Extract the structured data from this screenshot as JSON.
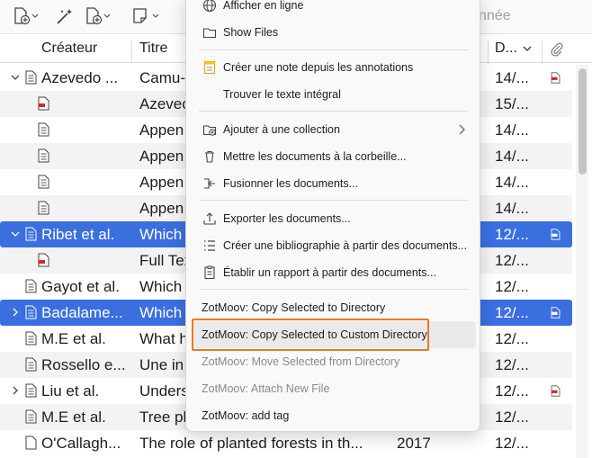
{
  "toolbar": {
    "new_item_icon": "new-item-icon",
    "magic_wand_icon": "magic-wand-icon",
    "attachment_icon": "add-attachment-icon",
    "note_icon": "new-note-icon",
    "search_placeholder": "nnée"
  },
  "columns": {
    "creator": "Créateur",
    "title": "Titre",
    "date": "D..."
  },
  "rows": [
    {
      "creator": "Azevedo ...",
      "title": "Camu-",
      "date": "14/...",
      "type": "parent",
      "expanded": true,
      "attach": "pdf"
    },
    {
      "creator": "",
      "title": "Azevec",
      "date": "15/...",
      "type": "child-pdf"
    },
    {
      "creator": "",
      "title": "Appen",
      "date": "14/...",
      "type": "child-doc"
    },
    {
      "creator": "",
      "title": "Appen",
      "date": "14/...",
      "type": "child-doc"
    },
    {
      "creator": "",
      "title": "Appen",
      "date": "14/...",
      "type": "child-doc"
    },
    {
      "creator": "",
      "title": "Appen",
      "date": "14/...",
      "type": "child-doc"
    },
    {
      "creator": "Ribet et al.",
      "title": "Which",
      "date": "12/...",
      "type": "parent",
      "expanded": true,
      "selected": true,
      "attach": "snapshot"
    },
    {
      "creator": "",
      "title": "Full Tex",
      "date": "12/...",
      "type": "child-pdf"
    },
    {
      "creator": "Gayot et al.",
      "title": "Which",
      "date": "12/...",
      "type": "parent"
    },
    {
      "creator": "Badalame...",
      "title": "Which",
      "date": "12/...",
      "type": "parent",
      "collapsed": true,
      "selected": true,
      "attach": "snapshot"
    },
    {
      "creator": "M.E et al.",
      "title": "What h",
      "date": "12/...",
      "type": "parent"
    },
    {
      "creator": "Rossello e...",
      "title": "Une in",
      "date": "12/...",
      "type": "parent"
    },
    {
      "creator": "Liu et al.",
      "title": "Unders",
      "date": "12/...",
      "type": "parent",
      "collapsed": true,
      "attach": "pdf"
    },
    {
      "creator": "M.E et al.",
      "title": "Tree pl",
      "date": "12/...",
      "type": "parent"
    },
    {
      "creator": "O'Callagh...",
      "title": "The role of planted forests in th...",
      "year": "2017",
      "date": "12/...",
      "type": "parent-blank"
    }
  ],
  "menu": {
    "view_online": "Afficher en ligne",
    "show_files": "Show Files",
    "note_from_annotations": "Créer une note depuis les annotations",
    "find_full_text": "Trouver le texte intégral",
    "add_to_collection": "Ajouter à une collection",
    "move_to_trash": "Mettre les documents à la corbeille...",
    "merge": "Fusionner les documents...",
    "export": "Exporter les documents...",
    "create_bibliography": "Créer une bibliographie à partir des documents...",
    "create_report": "Établir un rapport à partir des documents...",
    "zm_copy": "ZotMoov: Copy Selected to Directory",
    "zm_copy_custom": "ZotMoov: Copy Selected to Custom Directory",
    "zm_move_from": "ZotMoov: Move Selected from Directory",
    "zm_attach": "ZotMoov: Attach New File",
    "zm_tag": "ZotMoov: add tag"
  },
  "colors": {
    "selection": "#3b6fe0",
    "highlight_border": "#ea7a22",
    "pdf_red": "#d9262c"
  }
}
